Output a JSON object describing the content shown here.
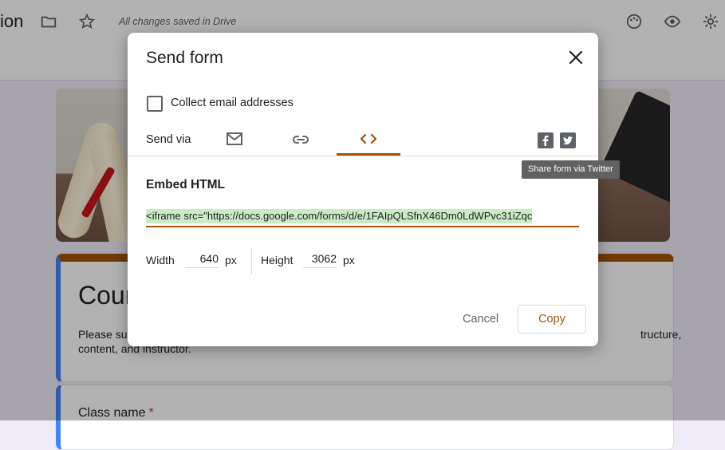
{
  "background": {
    "title_fragment": "ion",
    "saved_status": "All changes saved in Drive",
    "form_title_fragment": "Cour",
    "description_left": "Please sub",
    "description_left_line2": "content, and instructor.",
    "description_right": "tructure,",
    "question_label": "Class name",
    "required_star": "*"
  },
  "dialog": {
    "title": "Send form",
    "collect_email_label": "Collect email addresses",
    "collect_email_checked": false,
    "send_via_label": "Send via",
    "tabs": [
      {
        "icon": "email-icon",
        "selected": false
      },
      {
        "icon": "link-icon",
        "selected": false
      },
      {
        "icon": "embed-code-icon",
        "selected": true
      }
    ],
    "social": [
      {
        "icon": "facebook-icon"
      },
      {
        "icon": "twitter-icon"
      }
    ],
    "tooltip": "Share form via Twitter",
    "section_title": "Embed HTML",
    "embed_code": "<iframe src=\"https://docs.google.com/forms/d/e/1FAIpQLSfnX46Dm0LdWPvc31iZqc",
    "width_label": "Width",
    "width_value": "640",
    "height_label": "Height",
    "height_value": "3062",
    "unit": "px",
    "cancel_label": "Cancel",
    "copy_label": "Copy"
  },
  "colors": {
    "accent": "#a1540a",
    "selection_highlight": "#c9ecc4",
    "tooltip_bg": "#616161"
  }
}
